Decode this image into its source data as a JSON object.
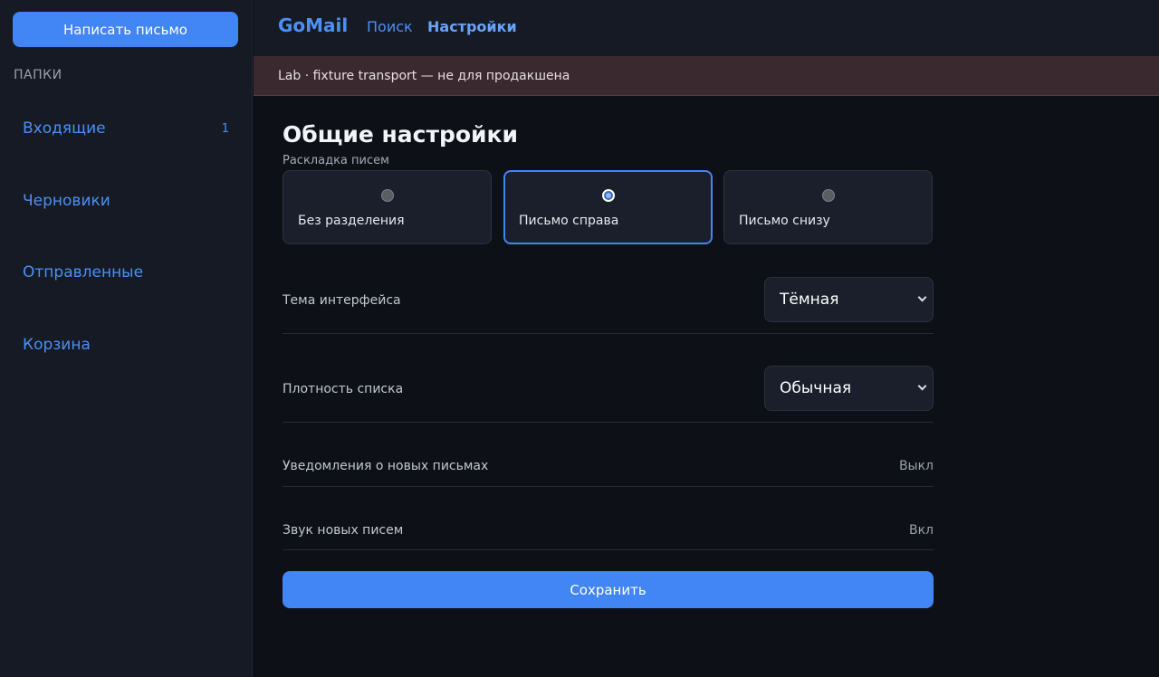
{
  "sidebar": {
    "compose_label": "Написать письмо",
    "folders_heading": "ПАПКИ",
    "folders": [
      {
        "label": "Входящие",
        "count": "1"
      },
      {
        "label": "Черновики",
        "count": ""
      },
      {
        "label": "Отправленные",
        "count": ""
      },
      {
        "label": "Корзина",
        "count": ""
      }
    ]
  },
  "header": {
    "brand": "GoMail",
    "nav": [
      {
        "label": "Поиск",
        "active": false
      },
      {
        "label": "Настройки",
        "active": true
      }
    ]
  },
  "banner": {
    "text": "Lab · fixture transport — не для продакшена"
  },
  "main": {
    "title": "Общие настройки",
    "layout": {
      "label": "Раскладка писем",
      "options": [
        {
          "label": "Без разделения",
          "selected": false
        },
        {
          "label": "Письмо справа",
          "selected": true
        },
        {
          "label": "Письмо снизу",
          "selected": false
        }
      ]
    },
    "settings": {
      "theme": {
        "label": "Тема интерфейса",
        "value": "Тёмная"
      },
      "density": {
        "label": "Плотность списка",
        "value": "Обычная"
      },
      "notifications": {
        "label": "Уведомления о новых письмах",
        "value": "Выкл"
      },
      "sound": {
        "label": "Звук новых писем",
        "value": "Вкл"
      }
    },
    "save_label": "Сохранить"
  },
  "colors": {
    "accent": "#4285f4",
    "link": "#4c90f5",
    "background": "#0d1017",
    "panel": "#161a24",
    "banner": "#3a2a2f"
  }
}
